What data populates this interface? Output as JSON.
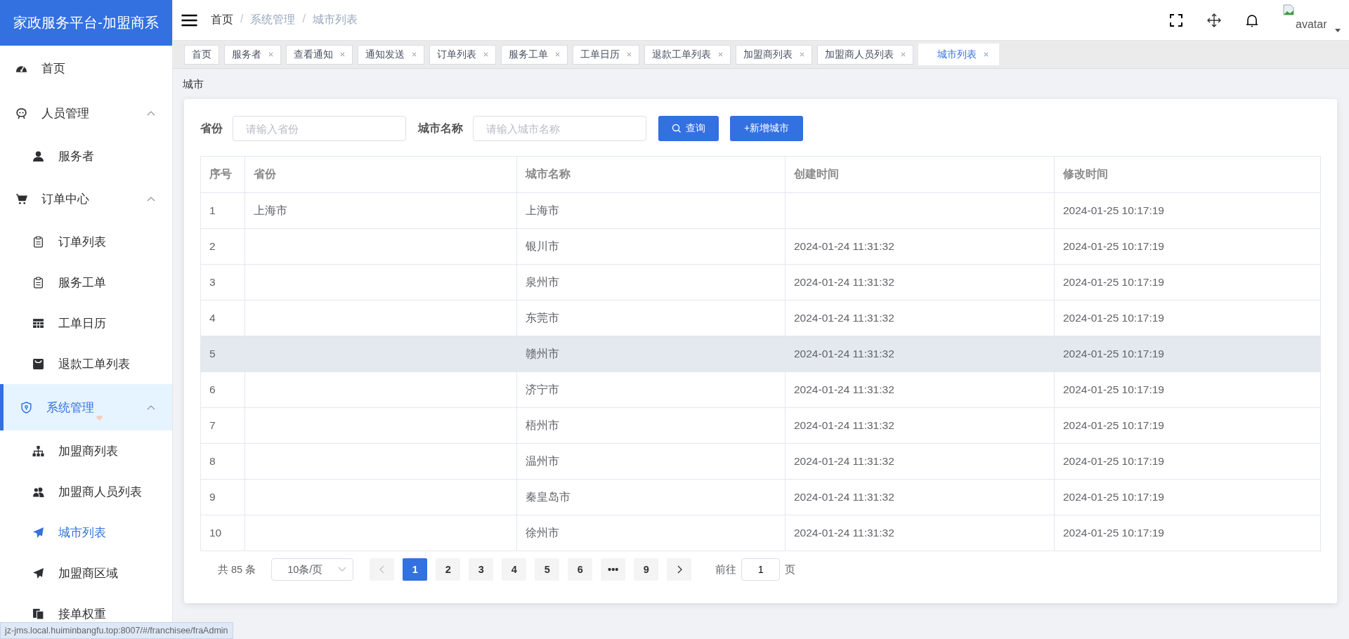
{
  "sidebar": {
    "title": "家政服务平台-加盟商系",
    "items": [
      {
        "label": "首页",
        "kind": "item",
        "selected": false
      },
      {
        "label": "人员管理",
        "kind": "group",
        "expanded": true,
        "active": false,
        "children": [
          {
            "label": "服务者",
            "kind": "item",
            "selected": false
          }
        ]
      },
      {
        "label": "订单中心",
        "kind": "group",
        "expanded": true,
        "active": false,
        "children": [
          {
            "label": "订单列表",
            "kind": "item",
            "selected": false
          },
          {
            "label": "服务工单",
            "kind": "item",
            "selected": false
          },
          {
            "label": "工单日历",
            "kind": "item",
            "selected": false
          },
          {
            "label": "退款工单列表",
            "kind": "item",
            "selected": false
          }
        ]
      },
      {
        "label": "系统管理",
        "kind": "group",
        "expanded": true,
        "active": true,
        "children": [
          {
            "label": "加盟商列表",
            "kind": "item",
            "selected": false
          },
          {
            "label": "加盟商人员列表",
            "kind": "item",
            "selected": false
          },
          {
            "label": "城市列表",
            "kind": "item",
            "selected": true
          },
          {
            "label": "加盟商区域",
            "kind": "item",
            "selected": false
          },
          {
            "label": "接单权重",
            "kind": "item",
            "selected": false
          }
        ]
      }
    ]
  },
  "breadcrumb": [
    {
      "kind": "crumb",
      "label": "首页",
      "current": false
    },
    {
      "kind": "separator",
      "label": "/"
    },
    {
      "kind": "crumb",
      "label": "系统管理",
      "current": true
    },
    {
      "kind": "separator",
      "label": "/"
    },
    {
      "kind": "crumb",
      "label": "城市列表",
      "current": true
    }
  ],
  "header": {
    "avatar_alt": "avatar"
  },
  "tabs": [
    {
      "label": "首页",
      "closable": false,
      "selected": false
    },
    {
      "label": "服务者",
      "closable": true,
      "selected": false
    },
    {
      "label": "查看通知",
      "closable": true,
      "selected": false
    },
    {
      "label": "通知发送",
      "closable": true,
      "selected": false
    },
    {
      "label": "订单列表",
      "closable": true,
      "selected": false
    },
    {
      "label": "服务工单",
      "closable": true,
      "selected": false
    },
    {
      "label": "工单日历",
      "closable": true,
      "selected": false
    },
    {
      "label": "退款工单列表",
      "closable": true,
      "selected": false
    },
    {
      "label": "加盟商列表",
      "closable": true,
      "selected": false
    },
    {
      "label": "加盟商人员列表",
      "closable": true,
      "selected": false
    },
    {
      "label": "城市列表",
      "closable": true,
      "selected": true
    }
  ],
  "page_title": "城市",
  "filters": [
    {
      "label": "省份",
      "placeholder": "请输入省份"
    },
    {
      "label": "城市名称",
      "placeholder": "请输入城市名称"
    }
  ],
  "buttons": [
    {
      "label": "查询",
      "kind": "search"
    },
    {
      "label": "+新增城市",
      "kind": "add"
    }
  ],
  "table": {
    "columns": [
      "序号",
      "省份",
      "城市名称",
      "创建时间",
      "修改时间"
    ],
    "rows": [
      {
        "cells": [
          "1",
          "上海市",
          "上海市",
          "",
          "2024-01-25 10:17:19"
        ],
        "hovered": false
      },
      {
        "cells": [
          "2",
          "",
          "银川市",
          "2024-01-24 11:31:32",
          "2024-01-25 10:17:19"
        ],
        "hovered": false
      },
      {
        "cells": [
          "3",
          "",
          "泉州市",
          "2024-01-24 11:31:32",
          "2024-01-25 10:17:19"
        ],
        "hovered": false
      },
      {
        "cells": [
          "4",
          "",
          "东莞市",
          "2024-01-24 11:31:32",
          "2024-01-25 10:17:19"
        ],
        "hovered": false
      },
      {
        "cells": [
          "5",
          "",
          "赣州市",
          "2024-01-24 11:31:32",
          "2024-01-25 10:17:19"
        ],
        "hovered": true
      },
      {
        "cells": [
          "6",
          "",
          "济宁市",
          "2024-01-24 11:31:32",
          "2024-01-25 10:17:19"
        ],
        "hovered": false
      },
      {
        "cells": [
          "7",
          "",
          "梧州市",
          "2024-01-24 11:31:32",
          "2024-01-25 10:17:19"
        ],
        "hovered": false
      },
      {
        "cells": [
          "8",
          "",
          "温州市",
          "2024-01-24 11:31:32",
          "2024-01-25 10:17:19"
        ],
        "hovered": false
      },
      {
        "cells": [
          "9",
          "",
          "秦皇岛市",
          "2024-01-24 11:31:32",
          "2024-01-25 10:17:19"
        ],
        "hovered": false
      },
      {
        "cells": [
          "10",
          "",
          "徐州市",
          "2024-01-24 11:31:32",
          "2024-01-25 10:17:19"
        ],
        "hovered": false
      }
    ]
  },
  "pagination": {
    "total": "共 85 条",
    "page_size": "10条/页",
    "pages": [
      {
        "label": "1",
        "selected": true
      },
      {
        "label": "2",
        "selected": false
      },
      {
        "label": "3",
        "selected": false
      },
      {
        "label": "4",
        "selected": false
      },
      {
        "label": "5",
        "selected": false
      },
      {
        "label": "6",
        "selected": false
      },
      {
        "label": "•••",
        "selected": false
      },
      {
        "label": "9",
        "selected": false
      }
    ],
    "prev_disabled": true,
    "goto_label": "前往",
    "goto_value": "1",
    "goto_suffix": "页"
  },
  "status_url": "jz-jms.local.huiminbangfu.top:8007/#/franchisee/fraAdmin"
}
